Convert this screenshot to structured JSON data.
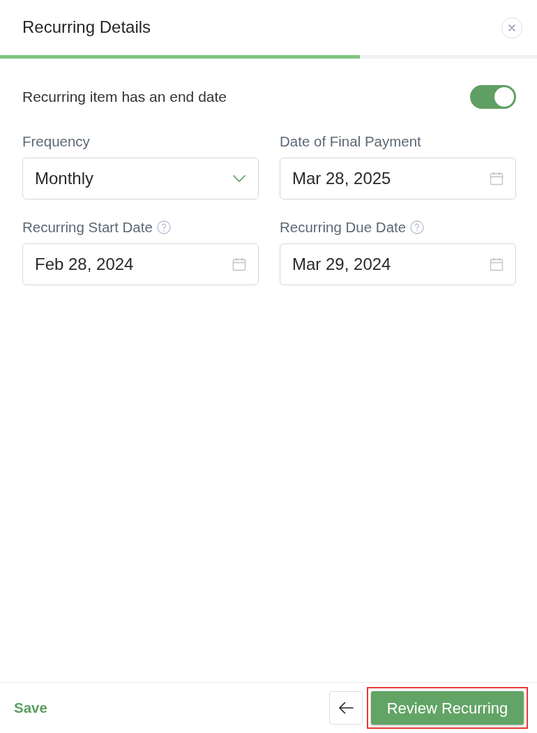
{
  "header": {
    "title": "Recurring Details"
  },
  "progress": {
    "level": 0.67
  },
  "end_date_toggle": {
    "label": "Recurring item has an end date",
    "on": true
  },
  "fields": [
    {
      "kind": "select",
      "label": "Frequency",
      "value": "Monthly",
      "help": false
    },
    {
      "kind": "date",
      "label": "Date of Final Payment",
      "value": "Mar 28, 2025",
      "help": false
    },
    {
      "kind": "date",
      "label": "Recurring Start Date",
      "value": "Feb 28, 2024",
      "help": true
    },
    {
      "kind": "date",
      "label": "Recurring Due Date",
      "value": "Mar 29, 2024",
      "help": true
    }
  ],
  "footer": {
    "save": "Save",
    "primary": {
      "label": "Review Recurring",
      "highlighted": true
    }
  }
}
